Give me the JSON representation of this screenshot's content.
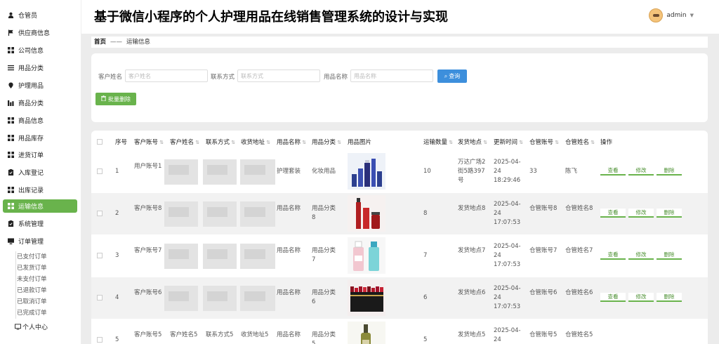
{
  "header": {
    "title": "基于微信小程序的个人护理用品在线销售管理系统的设计与实现",
    "user": "admin"
  },
  "sidebar": {
    "items": [
      {
        "label": "仓管员",
        "icon": "user-icon"
      },
      {
        "label": "供应商信息",
        "icon": "flag-icon"
      },
      {
        "label": "公司信息",
        "icon": "grid-icon"
      },
      {
        "label": "用品分类",
        "icon": "list-icon"
      },
      {
        "label": "护理用品",
        "icon": "pin-icon"
      },
      {
        "label": "商品分类",
        "icon": "chart-icon"
      },
      {
        "label": "商品信息",
        "icon": "grid-icon"
      },
      {
        "label": "用品库存",
        "icon": "grid-icon"
      },
      {
        "label": "进货订单",
        "icon": "grid-icon"
      },
      {
        "label": "入库登记",
        "icon": "clipboard-icon"
      },
      {
        "label": "出库记录",
        "icon": "grid-icon"
      },
      {
        "label": "运输信息",
        "icon": "grid-icon"
      },
      {
        "label": "系统管理",
        "icon": "clipboard-icon"
      },
      {
        "label": "订单管理",
        "icon": "monitor-icon"
      }
    ],
    "sub_items": [
      "已支付订单",
      "已发货订单",
      "未支付订单",
      "已退款订单",
      "已取消订单",
      "已完成订单"
    ],
    "personal_center": "个人中心"
  },
  "breadcrumb": {
    "home": "首页",
    "sep": "——",
    "current": "运输信息"
  },
  "search": {
    "customer_name_label": "客户姓名",
    "customer_name_placeholder": "客户姓名",
    "phone_label": "联系方式",
    "phone_placeholder": "联系方式",
    "product_name_label": "用品名称",
    "product_name_placeholder": "用品名称",
    "search_button": "查询",
    "batch_delete_button": "批量删除"
  },
  "table": {
    "headers": [
      "序号",
      "客户账号",
      "客户姓名",
      "联系方式",
      "收货地址",
      "用品名称",
      "用品分类",
      "用品图片",
      "运输数量",
      "发货地点",
      "更新时间",
      "仓管账号",
      "仓管姓名",
      "操作"
    ],
    "actions": {
      "view": "查看",
      "edit": "修改",
      "delete": "删除"
    },
    "rows": [
      {
        "index": "1",
        "account": "用户账号1",
        "product": "护理套装",
        "category": "化妆用品",
        "qty": "10",
        "origin": "万达广场2街5路397号",
        "time": "2025-04-24 18:29:46",
        "keeper_acct": "33",
        "keeper_name": "陈飞",
        "img": "bottles-blue"
      },
      {
        "index": "2",
        "account": "客户账号8",
        "product": "用品名称",
        "category": "用品分类8",
        "qty": "8",
        "origin": "发货地点8",
        "time": "2025-04-24 17:07:53",
        "keeper_acct": "仓管账号8",
        "keeper_name": "仓管姓名8",
        "img": "bottles-red"
      },
      {
        "index": "3",
        "account": "客户账号7",
        "product": "用品名称",
        "category": "用品分类7",
        "qty": "7",
        "origin": "发货地点7",
        "time": "2025-04-24 17:07:53",
        "keeper_acct": "仓管账号7",
        "keeper_name": "仓管姓名7",
        "img": "bottles-pink-teal"
      },
      {
        "index": "4",
        "account": "客户账号6",
        "product": "用品名称",
        "category": "用品分类6",
        "qty": "6",
        "origin": "发货地点6",
        "time": "2025-04-24 17:07:53",
        "keeper_acct": "仓管账号6",
        "keeper_name": "仓管姓名6",
        "img": "lipsticks"
      },
      {
        "index": "5",
        "account": "客户账号5",
        "name": "客户姓名5",
        "phone": "联系方式5",
        "address": "收货地址5",
        "product": "用品名称",
        "category": "用品分类5",
        "qty": "5",
        "origin": "发货地点5",
        "time": "2025-04-24 17:07:53",
        "keeper_acct": "仓管账号5",
        "keeper_name": "仓管姓名5",
        "img": "serum"
      }
    ]
  },
  "colors": {
    "accent": "#69b34c",
    "search_button": "#3d8fdc",
    "content_bg": "#ececec"
  }
}
